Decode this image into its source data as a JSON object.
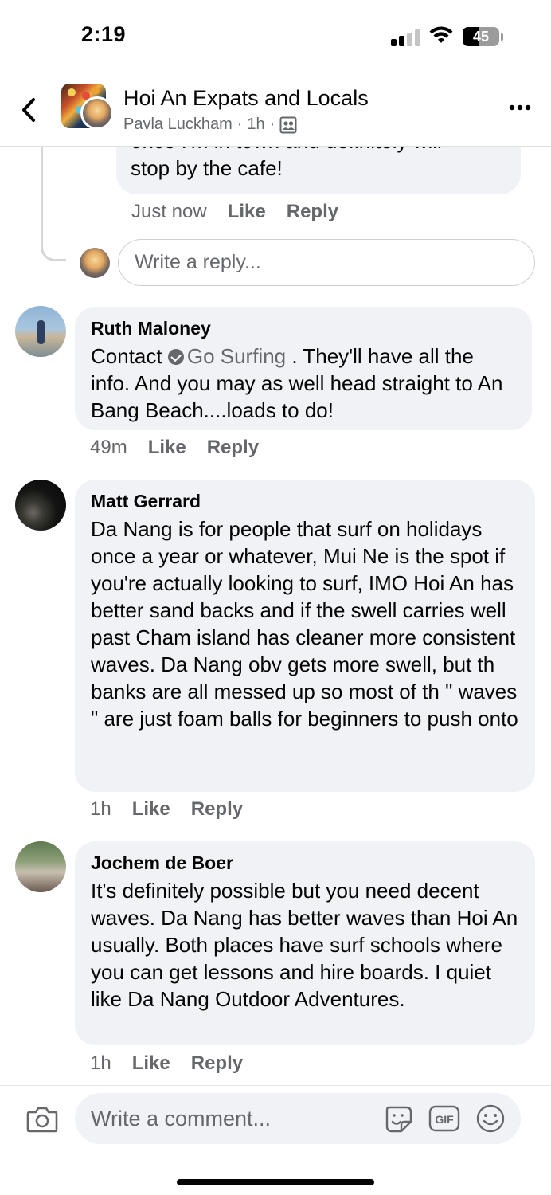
{
  "status_bar": {
    "time": "2:19",
    "battery_level": "45"
  },
  "header": {
    "group_name": "Hoi An Expats and Locals",
    "poster_name": "Pavla Luckham",
    "post_time": "1h",
    "audience_icon": "group-members-icon"
  },
  "previous_reply": {
    "text_partial": "once I'm in town and definitely will",
    "text_line2": "stop by the cafe!",
    "time": "Just now",
    "like_label": "Like",
    "reply_label": "Reply",
    "reply_placeholder": "Write a reply..."
  },
  "comments": [
    {
      "name": "Ruth Maloney",
      "text_before": "Contact",
      "mention": "Go Surfing",
      "text_after": ". They'll have all the info. And you may as well head straight to An Bang Beach....loads to do!",
      "time": "49m",
      "like_label": "Like",
      "reply_label": "Reply"
    },
    {
      "name": "Matt Gerrard",
      "text": "Da Nang is for people that surf on holidays once a year or whatever, Mui Ne is the spot if you're actually looking to surf, IMO Hoi An has better sand backs and if the swell carries well past Cham island has cleaner more consistent waves. Da Nang obv gets more swell, but th banks are all messed up so most of th \" waves \" are just foam balls for beginners to push onto",
      "time": "1h",
      "like_label": "Like",
      "reply_label": "Reply"
    },
    {
      "name": "Jochem de Boer",
      "text": "It's definitely possible but you need decent waves. Da Nang has better waves than Hoi An usually. Both places have surf schools where you can get lessons and hire boards. I quiet like Da Nang Outdoor Adventures.",
      "time": "1h",
      "like_label": "Like",
      "reply_label": "Reply"
    }
  ],
  "composer": {
    "placeholder": "Write a comment...",
    "gif_label": "GIF"
  }
}
